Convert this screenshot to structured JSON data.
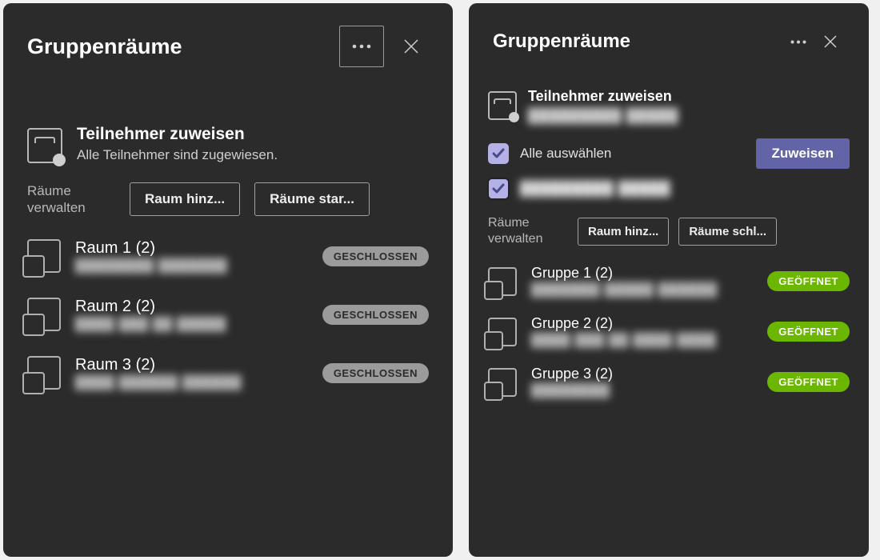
{
  "left": {
    "title": "Gruppenräume",
    "assign": {
      "heading": "Teilnehmer zuweisen",
      "subtext": "Alle Teilnehmer sind zugewiesen."
    },
    "manage_label": "Räume verwalten",
    "add_room_btn": "Raum hinz...",
    "start_rooms_btn": "Räume star...",
    "rooms": [
      {
        "name": "Raum 1 (2)",
        "sub": "████████ ███████",
        "status": "GESCHLOSSEN"
      },
      {
        "name": "Raum 2 (2)",
        "sub": "████ ███ ██ █████",
        "status": "GESCHLOSSEN"
      },
      {
        "name": "Raum 3 (2)",
        "sub": "████ ██████ ██████",
        "status": "GESCHLOSSEN"
      }
    ]
  },
  "right": {
    "title": "Gruppenräume",
    "assign": {
      "heading": "Teilnehmer zuweisen",
      "subtext": "█████████ █████"
    },
    "select_all": "Alle auswählen",
    "assign_btn": "Zuweisen",
    "participants": [
      {
        "name": "█████████ █████",
        "checked": true
      }
    ],
    "manage_label": "Räume verwalten",
    "add_room_btn": "Raum hinz...",
    "close_rooms_btn": "Räume schl...",
    "rooms": [
      {
        "name": "Gruppe 1 (2)",
        "sub": "███████ █████ ██████",
        "status": "GEÖFFNET"
      },
      {
        "name": "Gruppe 2 (2)",
        "sub": "████ ███ ██ ████ ████",
        "status": "GEÖFFNET"
      },
      {
        "name": "Gruppe 3 (2)",
        "sub": "████████",
        "status": "GEÖFFNET"
      }
    ]
  },
  "colors": {
    "bg_panel": "#2b2b2b",
    "accent": "#6264a7",
    "open_badge": "#6bb700",
    "closed_badge": "#9b9b9b"
  }
}
